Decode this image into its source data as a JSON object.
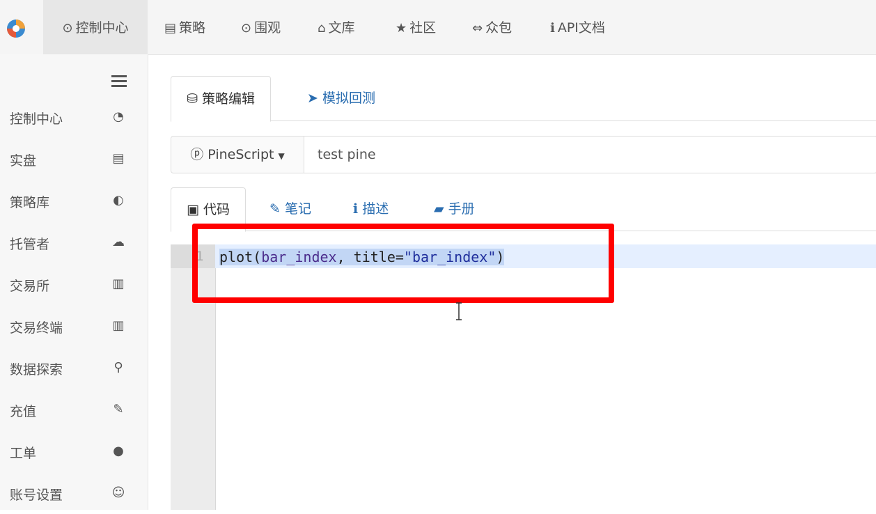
{
  "nav": {
    "items": [
      {
        "label": "控制中心",
        "icon": "clock-icon",
        "glyph": "⊙"
      },
      {
        "label": "策略",
        "icon": "cart-icon",
        "glyph": "🛒"
      },
      {
        "label": "围观",
        "icon": "eye-circle-icon",
        "glyph": "⊙"
      },
      {
        "label": "文库",
        "icon": "graduation-cap-icon",
        "glyph": "🎓"
      },
      {
        "label": "社区",
        "icon": "star-icon",
        "glyph": "★"
      },
      {
        "label": "众包",
        "icon": "arrows-icon",
        "glyph": "⇔"
      },
      {
        "label": "API文档",
        "icon": "info-icon",
        "glyph": "ℹ"
      }
    ]
  },
  "sidebar": {
    "items": [
      {
        "label": "控制中心",
        "icon": "dashboard-icon",
        "glyph": "◔"
      },
      {
        "label": "实盘",
        "icon": "monitor-icon",
        "glyph": "▤"
      },
      {
        "label": "策略库",
        "icon": "globe-icon",
        "glyph": "◐"
      },
      {
        "label": "托管者",
        "icon": "cloud-icon",
        "glyph": "☁"
      },
      {
        "label": "交易所",
        "icon": "bank-icon",
        "glyph": "🏛"
      },
      {
        "label": "交易终端",
        "icon": "bar-chart-icon",
        "glyph": "▥"
      },
      {
        "label": "数据探索",
        "icon": "search-icon",
        "glyph": "🔍"
      },
      {
        "label": "充值",
        "icon": "plug-icon",
        "glyph": "⚡"
      },
      {
        "label": "工单",
        "icon": "comment-icon",
        "glyph": "💬"
      },
      {
        "label": "账号设置",
        "icon": "user-circle-icon",
        "glyph": "☺"
      }
    ]
  },
  "editor_tabs": {
    "edit": {
      "label": "策略编辑",
      "icon": "users-icon",
      "glyph": "⛁"
    },
    "backtest": {
      "label": "模拟回测",
      "icon": "send-icon",
      "glyph": "➤"
    }
  },
  "strategy": {
    "language": "PineScript",
    "language_icon": "p-circle-icon",
    "name": "test pine"
  },
  "code_tabs": {
    "code": {
      "label": "代码",
      "icon": "file-icon",
      "glyph": "▣"
    },
    "notes": {
      "label": "笔记",
      "icon": "edit-icon",
      "glyph": "✎"
    },
    "desc": {
      "label": "描述",
      "icon": "info-icon",
      "glyph": "ℹ"
    },
    "manual": {
      "label": "手册",
      "icon": "book-icon",
      "glyph": "▰"
    }
  },
  "code": {
    "line_number": "1",
    "parts": {
      "fn": "plot(",
      "arg1": "bar_index",
      "mid": ", title=",
      "str": "\"bar_index\"",
      "close": ")"
    }
  },
  "colors": {
    "highlight_box": "#ff0000",
    "link": "#2a6db0",
    "selection": "#c2d6f5"
  }
}
